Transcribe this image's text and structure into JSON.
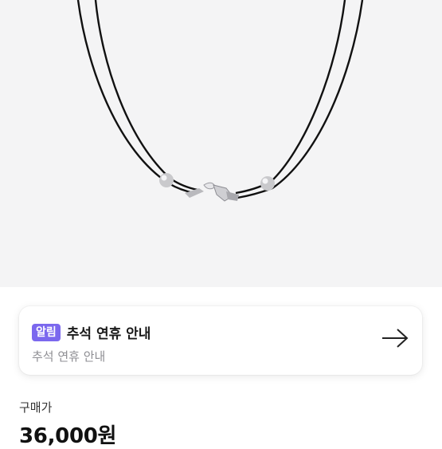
{
  "notice": {
    "badge": "알림",
    "title": "추석 연휴 안내",
    "subtitle": "추석 연휴 안내"
  },
  "price": {
    "label": "구매가",
    "value": "36,000원"
  },
  "colors": {
    "image_background": "#f4f4f5",
    "badge": "#7b68ee",
    "cord": "#111111"
  },
  "icons": {
    "notice_arrow": "arrow-right-icon"
  }
}
